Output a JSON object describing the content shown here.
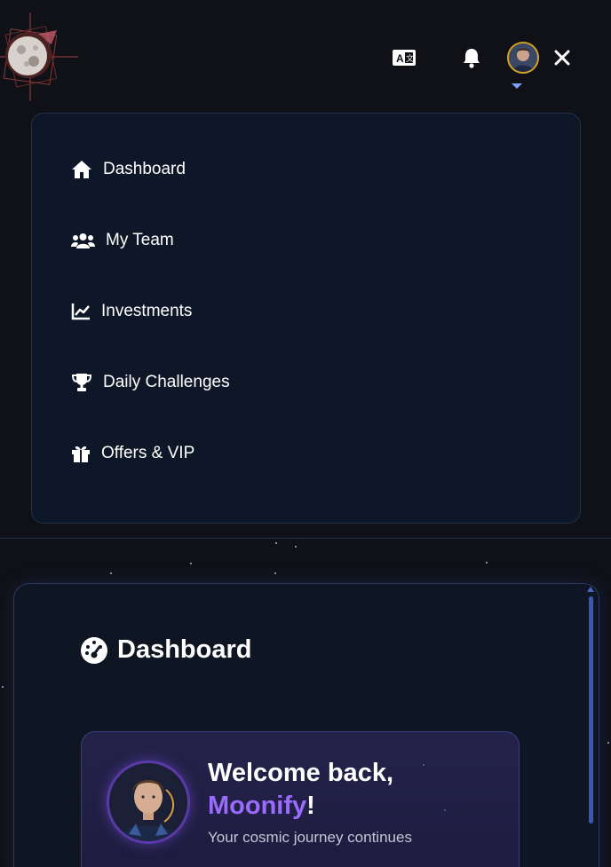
{
  "header": {
    "logo_icon": "moon-logo-icon",
    "translate_icon": "translate-icon",
    "notification_icon": "bell-icon",
    "avatar_icon": "user-avatar",
    "close_icon": "close-icon"
  },
  "menu": {
    "items": [
      {
        "label": "Dashboard",
        "icon": "home-icon"
      },
      {
        "label": "My Team",
        "icon": "users-icon"
      },
      {
        "label": "Investments",
        "icon": "chart-line-icon"
      },
      {
        "label": "Daily Challenges",
        "icon": "trophy-icon"
      },
      {
        "label": "Offers & VIP",
        "icon": "gift-icon"
      }
    ]
  },
  "main": {
    "title": "Dashboard",
    "title_icon": "gauge-icon",
    "welcome": {
      "line1": "Welcome back,",
      "name": "Moonify",
      "exclaim": "!",
      "subtitle": "Your cosmic journey continues"
    }
  },
  "colors": {
    "background": "#0f1116",
    "panel": "#0e1727",
    "accent_purple": "#9b6bff",
    "avatar_border": "#d9a520",
    "scrollbar": "#3a57b8"
  }
}
